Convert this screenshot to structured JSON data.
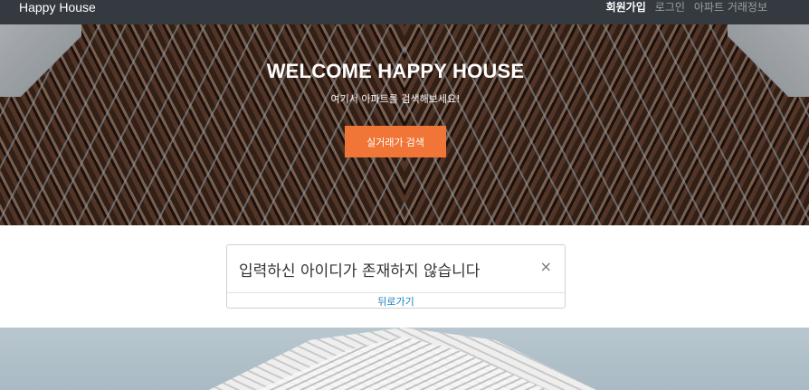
{
  "navbar": {
    "brand": "Happy House",
    "links": [
      {
        "label": "회원가입",
        "active": true
      },
      {
        "label": "로그인",
        "active": false
      },
      {
        "label": "아파트 거래정보",
        "active": false
      }
    ]
  },
  "hero": {
    "title": "WELCOME HAPPY HOUSE",
    "subtitle": "여기서 아파트를 검색해보세요!",
    "button_label": "실거래가 검색"
  },
  "alert": {
    "message": "입력하신 아이디가 존재하지 않습니다",
    "close_symbol": "×",
    "back_link": "뒤로가기"
  },
  "colors": {
    "navbar_bg": "#343a40",
    "accent_button": "#f07536",
    "link": "#1b7fbd"
  }
}
